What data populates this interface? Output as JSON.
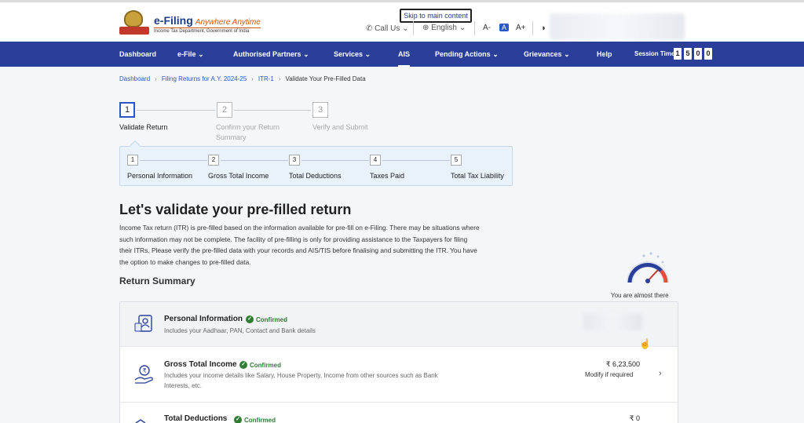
{
  "header": {
    "logo_title": "e-Filing",
    "logo_tagline": "Anywhere Anytime",
    "logo_subtitle": "Income Tax Department, Government of India",
    "skip_link": "Skip to main content",
    "call_us": "Call Us",
    "language": "English",
    "font_decrease": "A-",
    "font_default": "A",
    "font_increase": "A+",
    "contrast_icon": "contrast-icon"
  },
  "nav": {
    "items": [
      "Dashboard",
      "e-File",
      "Authorised Partners",
      "Services",
      "AIS",
      "Pending Actions",
      "Grievances",
      "Help"
    ],
    "dropdown_flags": [
      false,
      true,
      true,
      true,
      false,
      true,
      true,
      false
    ],
    "active": "AIS",
    "session_label": "Session Time",
    "timer": [
      "1",
      "5",
      "0",
      "0"
    ]
  },
  "breadcrumb": [
    "Dashboard",
    "Filing Returns for A.Y. 2024-25",
    "ITR-1",
    "Validate Your Pre-Filled Data"
  ],
  "main_steps": [
    {
      "num": "1",
      "label": "Validate Return",
      "active": true
    },
    {
      "num": "2",
      "label": "Confirm your Return Summary",
      "active": false
    },
    {
      "num": "3",
      "label": "Verify and Submit",
      "active": false
    }
  ],
  "sub_steps": [
    {
      "num": "1",
      "label": "Personal Information"
    },
    {
      "num": "2",
      "label": "Gross Total Income"
    },
    {
      "num": "3",
      "label": "Total Deductions"
    },
    {
      "num": "4",
      "label": "Taxes Paid"
    },
    {
      "num": "5",
      "label": "Total Tax Liability"
    }
  ],
  "content": {
    "headline": "Let's validate your pre-filled return",
    "intro": "Income Tax return (ITR) is pre-filled based on the information available for pre-fill on e-Filing. There may be situations where such information may not be complete. The facility of pre-filling is only for providing assistance to the Taxpayers for filing their ITRs. Please verify the pre-filled data with your records and AIS/TIS before finalising and submitting the ITR. You have the option to make changes to pre-filled data.",
    "summary_title": "Return Summary",
    "progress_label": "You are almost there"
  },
  "summary_rows": [
    {
      "title": "Personal Information",
      "status": "Confirmed",
      "desc": "Includes your Aadhaar, PAN, Contact and Bank details",
      "icon": "id-card-icon"
    },
    {
      "title": "Gross Total Income",
      "status": "Confirmed",
      "desc": "Includes your income details like Salary, House Property, Income from other sources such as Bank Interests, etc.",
      "amount": "₹ 6,23,500",
      "action": "Modify if required",
      "icon": "income-hand-icon"
    },
    {
      "title": "Total Deductions",
      "status": "Confirmed",
      "amount": "₹ 0",
      "icon": "deductions-icon"
    }
  ],
  "colors": {
    "nav_bg": "#2a3f9a",
    "accent": "#2a56c6",
    "confirmed": "#2e7d32"
  }
}
